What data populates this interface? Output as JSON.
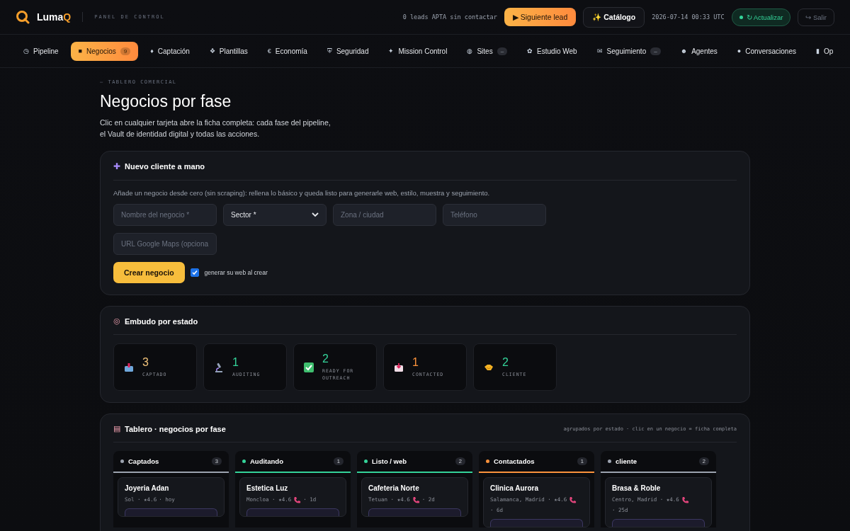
{
  "header": {
    "brand_prefix": "Luma",
    "brand_suffix": "Q",
    "subtitle": "PANEL DE CONTROL",
    "pending": "0 leads APTA sin contactar",
    "next_button": "▶ Siguiente lead",
    "catalog_button": "✨ Catálogo",
    "timestamp": "2026-07-14 00:33 UTC",
    "refresh_button": "↻ Actualizar",
    "logout_button": "↪ Salir"
  },
  "tabs": [
    {
      "icon": "◷",
      "label": "Pipeline",
      "selected": false
    },
    {
      "icon": "■",
      "label": "Negocios",
      "badge": "9",
      "selected": true
    },
    {
      "icon": "♦",
      "label": "Captación",
      "selected": false
    },
    {
      "icon": "❖",
      "label": "Plantillas",
      "selected": false
    },
    {
      "icon": "€",
      "label": "Economía",
      "selected": false
    },
    {
      "icon": "⛨",
      "label": "Seguridad",
      "selected": false
    },
    {
      "icon": "✦",
      "label": "Mission Control",
      "selected": false
    },
    {
      "icon": "◍",
      "label": "Sites",
      "badge": "–",
      "selected": false
    },
    {
      "icon": "✿",
      "label": "Estudio Web",
      "selected": false
    },
    {
      "icon": "✉",
      "label": "Seguimiento",
      "badge": "–",
      "selected": false
    },
    {
      "icon": "☻",
      "label": "Agentes",
      "selected": false
    },
    {
      "icon": "●",
      "label": "Conversaciones",
      "selected": false
    },
    {
      "icon": "▮",
      "label": "Op",
      "selected": false
    }
  ],
  "page": {
    "eyebrow": "— TABLERO COMERCIAL",
    "title": "Negocios por fase",
    "intro": "Clic en cualquier tarjeta abre la ficha completa: cada fase del pipeline, el Vault de identidad digital y todas las acciones."
  },
  "new_client": {
    "icon": "✚",
    "title": "Nuevo cliente a mano",
    "description": "Añade un negocio desde cero (sin scraping): rellena lo básico y queda listo para generarle web, estilo, muestra y seguimiento.",
    "name_placeholder": "Nombre del negocio *",
    "sector_value": "Sector *",
    "zone_placeholder": "Zona / ciudad",
    "phone_placeholder": "Teléfono",
    "maps_placeholder": "URL Google Maps (opciona",
    "create_button": "Crear negocio",
    "generate_web": {
      "label": "generar su web al crear",
      "checked": true
    }
  },
  "funnel": {
    "icon": "◎",
    "title": "Embudo por estado",
    "stages": [
      {
        "count": "3",
        "label": "CAPTADO",
        "color": "#f0c27a",
        "kind": "inbox"
      },
      {
        "count": "1",
        "label": "AUDITING",
        "color": "#34d399",
        "kind": "microscope"
      },
      {
        "count": "2",
        "label": "READY FOR OUTREACH",
        "color": "#34d399",
        "kind": "check"
      },
      {
        "count": "1",
        "label": "CONTACTED",
        "color": "#fb923c",
        "kind": "mail"
      },
      {
        "count": "2",
        "label": "CLIENTE",
        "color": "#34d399",
        "kind": "handshake"
      }
    ]
  },
  "board": {
    "icon": "▤",
    "title": "Tablero · negocios por fase",
    "hint": "agrupados por estado · clic en un negocio = ficha completa",
    "columns": [
      {
        "name": "Captados",
        "count": "3",
        "color": "#9ca3af",
        "cards": [
          {
            "name": "Joyeria Adan",
            "meta": "Sol · ★4.6",
            "phone": false,
            "age": "· hoy"
          }
        ]
      },
      {
        "name": "Auditando",
        "count": "1",
        "color": "#34d399",
        "cards": [
          {
            "name": "Estetica Luz",
            "meta": "Moncloa · ★4.6",
            "phone": true,
            "age": "· 1d"
          }
        ]
      },
      {
        "name": "Listo / web",
        "count": "2",
        "color": "#34d399",
        "cards": [
          {
            "name": "Cafeteria Norte",
            "meta": "Tetuan · ★4.6",
            "phone": true,
            "age": "· 2d"
          }
        ]
      },
      {
        "name": "Contactados",
        "count": "1",
        "color": "#fb923c",
        "cards": [
          {
            "name": "Clinica Aurora",
            "meta": "Salamanca, Madrid · ★4.6",
            "phone": true,
            "age": "· 6d"
          }
        ]
      },
      {
        "name": "cliente",
        "count": "2",
        "color": "#9ca3af",
        "cards": [
          {
            "name": "Brasa & Roble",
            "meta": "Centro, Madrid · ★4.6",
            "phone": true,
            "age": "· 25d"
          }
        ]
      }
    ]
  }
}
